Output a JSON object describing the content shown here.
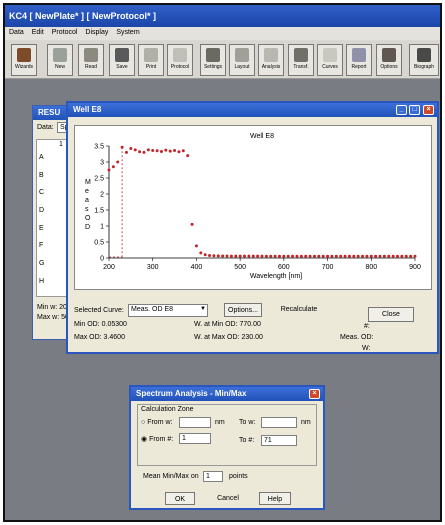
{
  "app": {
    "title": "KC4  [ NewPlate* ]  [ NewProtocol* ]"
  },
  "menu": [
    "Data",
    "Edit",
    "Protocol",
    "Display",
    "System"
  ],
  "toolbar": [
    "Wizards",
    "New",
    "Read",
    "Save",
    "Print",
    "Protocol",
    "Settings",
    "Layout",
    "Analysis",
    "Transf.",
    "Curves",
    "Report",
    "Options",
    "Biograph"
  ],
  "results_window": {
    "title": "RESU",
    "data_label": "Data:",
    "data_value": "Sp",
    "col1": "1",
    "rows": [
      "A",
      "B",
      "C",
      "D",
      "E",
      "F",
      "G",
      "H"
    ],
    "min_line": "Min w: 20",
    "max_line": "Max w: 50"
  },
  "well_window": {
    "title": "Well E8",
    "plot_title": "Well E8",
    "selected_curve_label": "Selected Curve:",
    "selected_curve_value": "Meas. OD E8",
    "options_button": "Options...",
    "recalculate_button": "Recalculate",
    "close_button": "Close",
    "min_od": "Min OD: 0.05300",
    "max_od": "Max OD: 3.4600",
    "w_min": "W. at Min OD: 770.00",
    "w_max": "W. at Max OD: 230.00",
    "hash_label": "#:",
    "meas_od_label": "Meas. OD:",
    "w_label": "W:"
  },
  "spectrum_dialog": {
    "title": "Spectrum Analysis - Min/Max",
    "zone_label": "Calculation Zone",
    "from_w_label": "From w:",
    "to_w_label": "To w:",
    "nm1": "nm",
    "nm2": "nm",
    "from_hash_label": "From #:",
    "from_hash_value": "1",
    "to_hash_label": "To #:",
    "to_hash_value": "71",
    "mean_label": "Mean Min/Max on",
    "mean_value": "1",
    "points_label": "points",
    "ok_button": "OK",
    "cancel_button": "Cancel",
    "help_button": "Help"
  },
  "chart_data": {
    "type": "scatter",
    "title": "Well E8",
    "xlabel": "Wavelength [nm]",
    "ylabel": "Meas. OD",
    "xlim": [
      200,
      900
    ],
    "ylim": [
      0,
      3.5
    ],
    "xticks": [
      200,
      300,
      400,
      500,
      600,
      700,
      800,
      900
    ],
    "yticks": [
      0,
      0.5,
      1,
      1.5,
      2,
      2.5,
      3,
      3.5
    ],
    "marker_line_x": 230,
    "series": [
      {
        "x": [
          200,
          210,
          220,
          230,
          240,
          250,
          260,
          270,
          280,
          290,
          300,
          310,
          320,
          330,
          340,
          350,
          360,
          370,
          380,
          390,
          400,
          410,
          420,
          430,
          440,
          450,
          460,
          470,
          480,
          490,
          500,
          510,
          520,
          530,
          540,
          550,
          560,
          570,
          580,
          590,
          600,
          610,
          620,
          630,
          640,
          650,
          660,
          670,
          680,
          690,
          700,
          710,
          720,
          730,
          740,
          750,
          760,
          770,
          780,
          790,
          800,
          810,
          820,
          830,
          840,
          850,
          860,
          870,
          880,
          890,
          900
        ],
        "y": [
          2.75,
          2.85,
          3.0,
          3.46,
          3.3,
          3.42,
          3.38,
          3.32,
          3.3,
          3.38,
          3.36,
          3.35,
          3.33,
          3.37,
          3.34,
          3.36,
          3.32,
          3.35,
          3.2,
          1.05,
          0.38,
          0.16,
          0.1,
          0.08,
          0.07,
          0.066,
          0.064,
          0.062,
          0.06,
          0.06,
          0.06,
          0.058,
          0.058,
          0.057,
          0.057,
          0.057,
          0.056,
          0.056,
          0.056,
          0.056,
          0.055,
          0.055,
          0.055,
          0.055,
          0.055,
          0.055,
          0.054,
          0.054,
          0.054,
          0.054,
          0.054,
          0.054,
          0.054,
          0.054,
          0.054,
          0.054,
          0.054,
          0.053,
          0.054,
          0.054,
          0.054,
          0.054,
          0.054,
          0.054,
          0.054,
          0.054,
          0.054,
          0.054,
          0.054,
          0.054,
          0.054
        ]
      }
    ]
  }
}
